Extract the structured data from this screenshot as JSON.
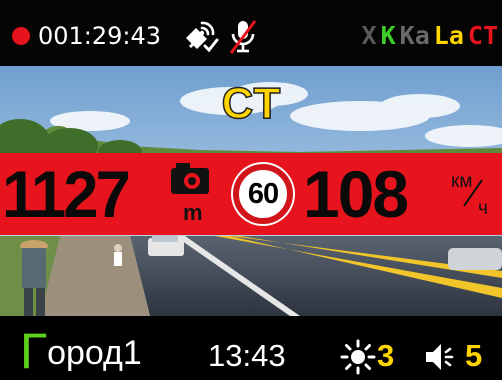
{
  "status_bar": {
    "recording_indicator_color": "#e8141d",
    "recording_time": "001:29:43",
    "gps_icon": "gps-satellite-icon",
    "mic_icon": "microphone-muted-icon",
    "bands": [
      {
        "label": "X",
        "color": "#5a5a5a"
      },
      {
        "label": "K",
        "color": "#3fcf2a"
      },
      {
        "label": "Ka",
        "color": "#6a6a6a"
      },
      {
        "label": "La",
        "color": "#ffd400"
      },
      {
        "label": "CT",
        "color": "#e8141d"
      }
    ]
  },
  "alert": {
    "type_label": "CT",
    "type_color": "#ffd400",
    "band_color": "#e8141d",
    "distance_value": "1127",
    "distance_unit": "m",
    "camera_icon": "speed-camera-icon",
    "speed_limit": "60",
    "current_speed": "108",
    "speed_unit_top": "км",
    "speed_unit_bottom": "ч"
  },
  "bottom_bar": {
    "city_first_letter": "Г",
    "city_rest": "ород1",
    "mode_color": "#5ed11c",
    "clock": "13:43",
    "brightness_icon": "brightness-sun-icon",
    "brightness_level": "3",
    "volume_icon": "speaker-volume-icon",
    "volume_level": "5",
    "level_color": "#ffd400"
  }
}
